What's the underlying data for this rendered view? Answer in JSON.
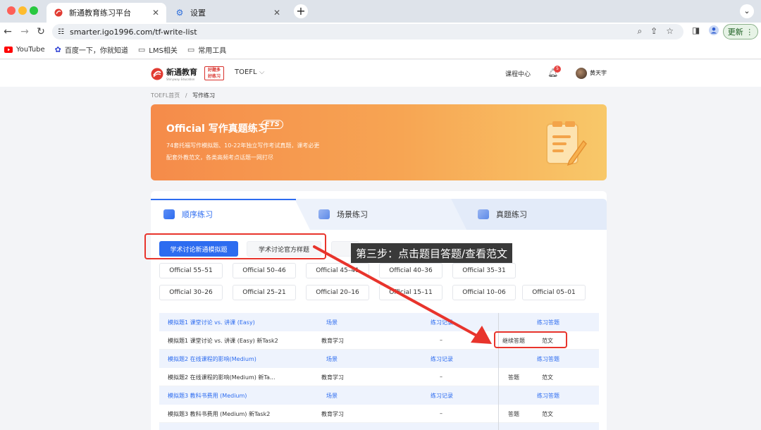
{
  "browser": {
    "tabs": [
      {
        "title": "新通教育练习平台",
        "active": true
      },
      {
        "title": "设置",
        "active": false
      }
    ],
    "url": "smarter.igo1996.com/tf-write-list",
    "update_label": "更新",
    "bookmarks": [
      "YouTube",
      "百度一下，你就知道",
      "LMS相关",
      "常用工具"
    ]
  },
  "site": {
    "logo_text": "新通教育",
    "logo_sub": "Shinyway Education",
    "badge_text": [
      "好题多",
      "好练习"
    ],
    "product": "TOEFL",
    "course_center": "课程中心",
    "notification_count": "5",
    "username": "黄天宇"
  },
  "breadcrumb": {
    "home": "TOEFL首页",
    "sep": "/",
    "current": "写作练习"
  },
  "hero": {
    "title": "Official 写作真题练习",
    "badge": "ETS",
    "line1": "74套托福写作模拟题、10-22年独立写作考试真题，课考必更",
    "line2": "配套外教范文，各类高频考点话题一网打尽"
  },
  "main_tabs": [
    {
      "label": "顺序练习",
      "active": true
    },
    {
      "label": "场景练习",
      "active": false
    },
    {
      "label": "真题练习",
      "active": false
    }
  ],
  "sub_tabs": [
    {
      "label": "学术讨论新通模拟题",
      "active": true
    },
    {
      "label": "学术讨论官方样题",
      "active": false
    }
  ],
  "official_sets": [
    "Official 55–51",
    "Official 50–46",
    "Official 45–41",
    "Official 40–36",
    "Official 35–31",
    "Official 30–26",
    "Official 25–21",
    "Official 20–16",
    "Official 15–11",
    "Official 10–06",
    "Official 05–01"
  ],
  "table": {
    "header_labels": {
      "scene": "场景",
      "record": "练习记录",
      "action": "练习答题"
    },
    "groups": [
      {
        "title": "模拟题1 课堂讨论 vs. 讲课 (Easy)",
        "row": {
          "name": "模拟题1 课堂讨论 vs. 讲课 (Easy) 新Task2",
          "scene": "教育学习",
          "record": "–",
          "action1": "继续答题",
          "action2": "范文"
        }
      },
      {
        "title": "模拟题2 在线课程的影响(Medium)",
        "row": {
          "name": "模拟题2 在线课程的影响(Medium) 新Ta...",
          "scene": "教育学习",
          "record": "–",
          "action1": "答题",
          "action2": "范文"
        }
      },
      {
        "title": "模拟题3 教科书费用 (Medium)",
        "row": {
          "name": "模拟题3 教科书费用 (Medium) 新Task2",
          "scene": "教育学习",
          "record": "–",
          "action1": "答题",
          "action2": "范文"
        }
      }
    ]
  },
  "annotation": {
    "callout": "第三步：点击题目答题/查看范文"
  },
  "colors": {
    "accent": "#2d6cf0",
    "red": "#e8342c",
    "hero_start": "#f58b4a",
    "hero_end": "#f8c869"
  }
}
